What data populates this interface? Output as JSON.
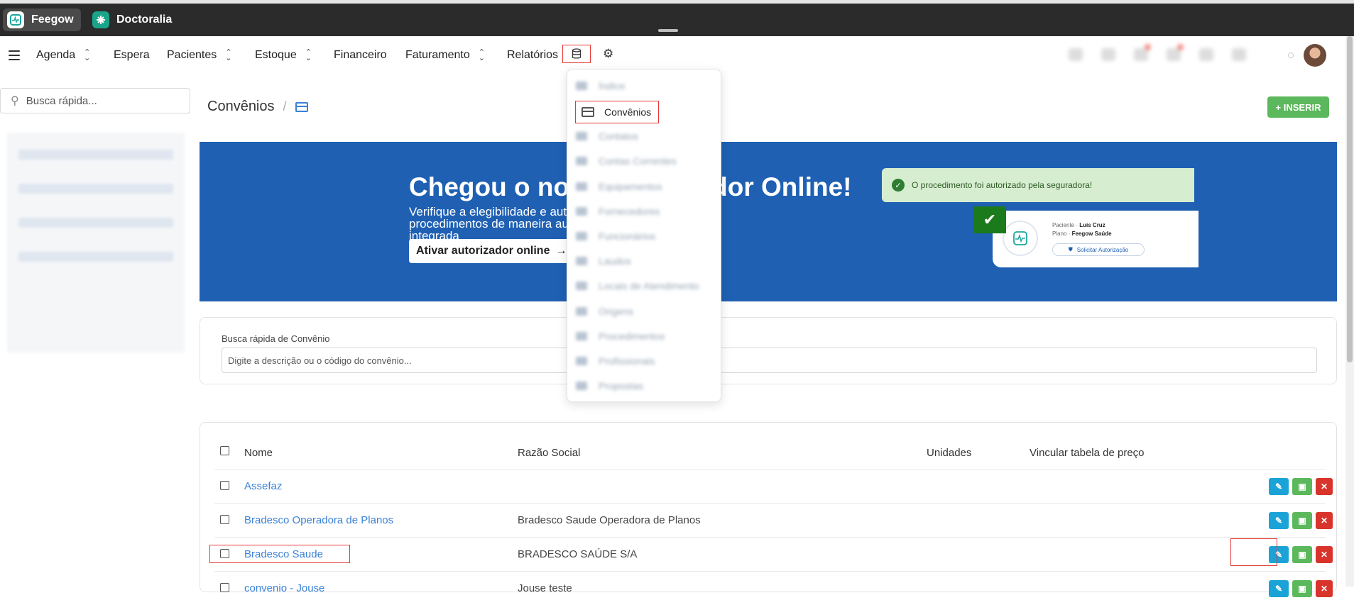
{
  "apps": {
    "feegow": "Feegow",
    "doctoralia": "Doctoralia"
  },
  "nav": {
    "agenda": "Agenda",
    "espera": "Espera",
    "pacientes": "Pacientes",
    "estoque": "Estoque",
    "financeiro": "Financeiro",
    "faturamento": "Faturamento",
    "relatorios": "Relatórios"
  },
  "sidebar": {
    "search_placeholder": "Busca rápida..."
  },
  "page": {
    "title": "Convênios",
    "insert_label": "+ INSERIR"
  },
  "banner": {
    "title": "Chegou o novo Autorizador Online!",
    "subtitle": "Verifique a elegibilidade e autorize procedimentos de maneira automática e integrada",
    "button": "Ativar autorizador online",
    "toast": "O procedimento foi autorizado pela seguradora!",
    "card_patient_label": "Paciente · ",
    "card_patient": "Luis Cruz",
    "card_plan_label": "Plano · ",
    "card_plan": "Feegow Saúde",
    "card_button": "Solicitar Autorização"
  },
  "quick_search": {
    "label": "Busca rápida de Convênio",
    "placeholder": "Digite a descrição ou o código do convênio..."
  },
  "table": {
    "headers": {
      "nome": "Nome",
      "razao": "Razão Social",
      "unidades": "Unidades",
      "vincular": "Vincular tabela de preço"
    },
    "rows": [
      {
        "nome": "Assefaz",
        "razao": ""
      },
      {
        "nome": "Bradesco Operadora de Planos",
        "razao": "Bradesco Saude Operadora de Planos"
      },
      {
        "nome": "Bradesco Saude",
        "razao": "BRADESCO SAÚDE S/A"
      },
      {
        "nome": "convenio - Jouse",
        "razao": "Jouse teste"
      }
    ]
  },
  "dropdown": {
    "selected": "Convênios"
  },
  "colors": {
    "accent": "#1f60b3",
    "insert": "#5cb85c",
    "link": "#3b82d6",
    "highlight": "#e53935"
  }
}
